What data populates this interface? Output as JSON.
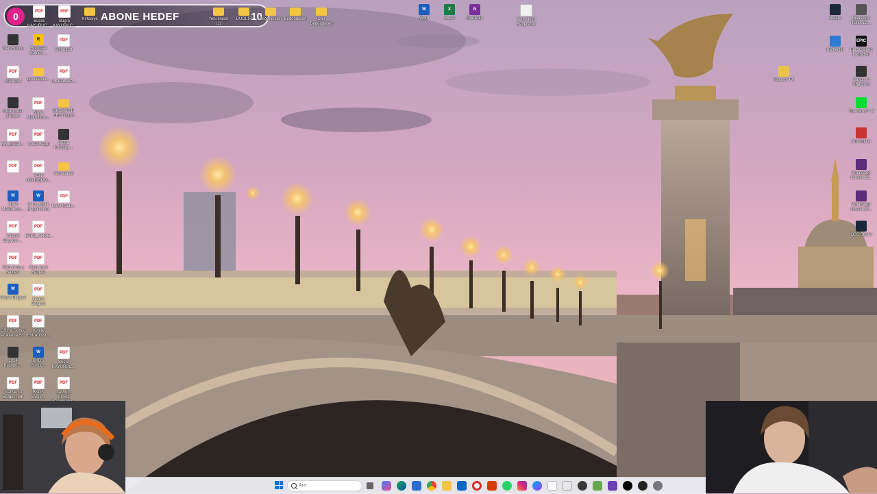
{
  "overlay": {
    "title": "ABONE HEDEF",
    "current": "0",
    "target": "10"
  },
  "desktop": {
    "top_row": [
      {
        "label": "Büşra KAYURUC...",
        "icon": "pdf-icon"
      },
      {
        "label": "Büşra KAYURUC...",
        "icon": "pdf-icon"
      },
      {
        "label": "Kırtasiye",
        "icon": "folder-icon"
      },
      {
        "label": "Yeni klasör (2)",
        "icon": "folder-icon"
      },
      {
        "label": "DUOLİR",
        "icon": "folder-icon"
      },
      {
        "label": "Beğendikleri",
        "icon": "folder-icon"
      },
      {
        "label": "Beğendikleri",
        "icon": "folder-icon"
      },
      {
        "label": "Can Beğendikleri",
        "icon": "folder-icon"
      }
    ],
    "office": [
      {
        "label": "Word",
        "icon": "word-icon"
      },
      {
        "label": "Excel",
        "icon": "excel-icon"
      },
      {
        "label": "OneNote",
        "icon": "onenote-icon"
      },
      {
        "label": "Yeni Metin Belgesi.txt",
        "icon": "text-file-icon"
      }
    ],
    "left_col1": [
      {
        "label": "Gen Sonuç",
        "icon": "app-icon"
      },
      {
        "label": "2024.pdf",
        "icon": "pdf-icon"
      },
      {
        "label": "Gelir-Gider (Tüdan",
        "icon": "app-icon"
      },
      {
        "label": "BB_2tıklan...",
        "icon": "pdf-icon"
      },
      {
        "label": "",
        "icon": "pdf-icon"
      },
      {
        "label": "Niyet Mektubum...",
        "icon": "word-icon"
      },
      {
        "label": "Yüksek Başvuru ...",
        "icon": "pdf-icon"
      },
      {
        "label": "2015 Sonuç Belgesi",
        "icon": "pdf-icon"
      },
      {
        "label": "Sınav Belgesi",
        "icon": "word-icon"
      },
      {
        "label": "ÖSYM Sonuç Açıklama S...",
        "icon": "pdf-icon"
      },
      {
        "label": "2024 Başvuru...",
        "icon": "app-icon"
      },
      {
        "label": "Transkript Belgesi.pdf",
        "icon": "pdf-icon"
      }
    ],
    "left_col2": [
      {
        "label": "Rockstar Games ...",
        "icon": "rockstar-icon"
      },
      {
        "label": "goodkeyel...",
        "icon": "folder-icon"
      },
      {
        "label": "Niyet Mektubum...",
        "icon": "pdf-icon"
      },
      {
        "label": "Yedek Kağıt",
        "icon": "pdf-icon"
      },
      {
        "label": "YENİ DÖNÜŞÜM...",
        "icon": "pdf-icon"
      },
      {
        "label": "Yeni Lojistik Belgeli.docx",
        "icon": "word-icon"
      },
      {
        "label": "ETKB_ARGE...",
        "icon": "pdf-icon"
      },
      {
        "label": "Mezuniyet Belgesi",
        "icon": "pdf-icon"
      },
      {
        "label": "Lisans Belgesi",
        "icon": "pdf-icon"
      },
      {
        "label": "Kimlik Fotokopisi...",
        "icon": "pdf-icon"
      },
      {
        "label": "BKDS Sonuç...",
        "icon": "word-icon"
      },
      {
        "label": "BKDS Sonuç...",
        "icon": "pdf-icon"
      }
    ],
    "left_col3": [
      {
        "label": "komp.pdf",
        "icon": "pdf-icon"
      },
      {
        "label": "ıc_ana_aka...",
        "icon": "pdf-icon"
      },
      {
        "label": "HÜSNÜ FİL FESTİ.pptx",
        "icon": "folder-icon"
      },
      {
        "label": "Büşra Kırtasiye...",
        "icon": "app-icon"
      },
      {
        "label": "Yeni klasör",
        "icon": "folder-icon"
      },
      {
        "label": "Downloads...",
        "icon": "pdf-icon"
      },
      {
        "label": "Büşra KAYURUC...",
        "icon": "pdf-icon"
      },
      {
        "label": "başvuru SUSO 15.04.2024...",
        "icon": "pdf-icon"
      }
    ],
    "right_col1": [
      {
        "label": "Steam",
        "icon": "steam-icon"
      },
      {
        "label": "BattleNet",
        "icon": "battlenet-icon"
      }
    ],
    "right_col2": [
      {
        "label": "Bilgisayar Hakkında ...",
        "icon": "gear-icon"
      },
      {
        "label": "Epic Games Launcher",
        "icon": "epic-icon"
      },
      {
        "label": "Sands of Shadows",
        "icon": "game-icon"
      },
      {
        "label": "The Sims™ 4",
        "icon": "sims-icon"
      },
      {
        "label": "Among Us",
        "icon": "among-us-icon"
      },
      {
        "label": "WhatsApp Görsel 20...",
        "icon": "image-icon"
      },
      {
        "label": "WhatsApp Görsel 20...",
        "icon": "image-icon"
      },
      {
        "label": "OBS Studio",
        "icon": "obs-icon"
      }
    ],
    "misc": {
      "label": "Hamam FX",
      "icon": "app-icon"
    }
  },
  "taskbar": {
    "search_placeholder": "Ara",
    "pinned": [
      "task-view-icon",
      "copilot-icon",
      "edge-icon",
      "store-icon",
      "chrome-icon",
      "file-explorer-icon",
      "mail-icon",
      "opera-icon",
      "office-icon",
      "whatsapp-icon",
      "instagram-icon",
      "messenger-icon",
      "photos-icon",
      "notepad-icon",
      "spotify-icon",
      "minecraft-icon",
      "vs-icon",
      "capcut-icon",
      "media-player-icon",
      "settings-icon"
    ]
  },
  "colors": {
    "overlay_accent": "#e0218a",
    "taskbar": "#eeeef4",
    "sky_top": "#c9a6bd",
    "sky_glow": "#e8b7c4"
  }
}
